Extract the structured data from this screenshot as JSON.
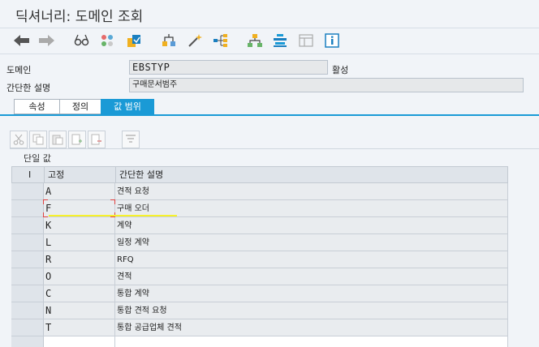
{
  "window": {
    "title": "딕셔너리: 도메인 조회"
  },
  "toolbar": {
    "icons": [
      "back-arrow-icon",
      "forward-arrow-icon",
      "glasses-icon",
      "objects-icon",
      "activate-icon",
      "where-used-icon",
      "magic-wand-icon",
      "hierarchy-icon",
      "network-icon",
      "stack-icon",
      "layout-icon",
      "info-icon"
    ]
  },
  "fields": {
    "domain_label": "도메인",
    "domain_value": "EBSTYP",
    "status": "활성",
    "short_desc_label": "간단한 설명",
    "short_desc_value": "구매문서범주"
  },
  "tabs": [
    {
      "label": "속성"
    },
    {
      "label": "정의"
    },
    {
      "label": "값 범위",
      "active": true
    }
  ],
  "table_toolbar": {
    "buttons": [
      "cut-icon",
      "copy-icon",
      "paste-icon",
      "insert-row-icon",
      "delete-row-icon",
      "filter-icon"
    ]
  },
  "section": {
    "title": "단일 값"
  },
  "grid": {
    "columns": {
      "sel": "I",
      "fixed": "고정",
      "desc": "간단한 설명"
    },
    "rows": [
      {
        "fixed": "A",
        "desc": "견적 요청"
      },
      {
        "fixed": "F",
        "desc": "구매 오더"
      },
      {
        "fixed": "K",
        "desc": "계약"
      },
      {
        "fixed": "L",
        "desc": "일정 계약"
      },
      {
        "fixed": "R",
        "desc": "RFQ"
      },
      {
        "fixed": "O",
        "desc": "견적"
      },
      {
        "fixed": "C",
        "desc": "통합 계약"
      },
      {
        "fixed": "N",
        "desc": "통합 견적 요청"
      },
      {
        "fixed": "T",
        "desc": "통합 공급업체 견적"
      }
    ]
  },
  "colors": {
    "accent": "#1a9ad6",
    "highlight": "#f7f12a"
  }
}
